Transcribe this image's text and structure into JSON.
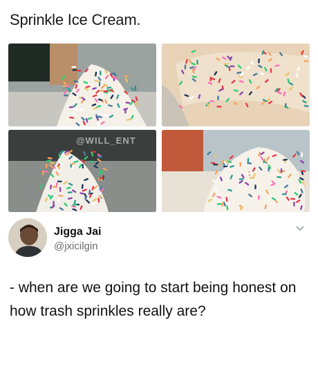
{
  "header": {
    "title": "Sprinkle Ice Cream."
  },
  "photos": {
    "watermark": "@WILL_ENT",
    "items": [
      {
        "alt": "sprinkle-cone-1"
      },
      {
        "alt": "sprinkle-cone-2"
      },
      {
        "alt": "sprinkle-cone-3"
      },
      {
        "alt": "sprinkle-cone-4"
      }
    ]
  },
  "tweet": {
    "display_name": "Jigga Jai",
    "handle": "@jxicilgin",
    "text": "- when are we going to start being honest on how trash sprinkles really are?"
  },
  "colors": {
    "text": "#111111",
    "handle": "#6b6b6b",
    "background": "#ffffff"
  },
  "icons": {
    "menu": "chevron-down-icon"
  }
}
